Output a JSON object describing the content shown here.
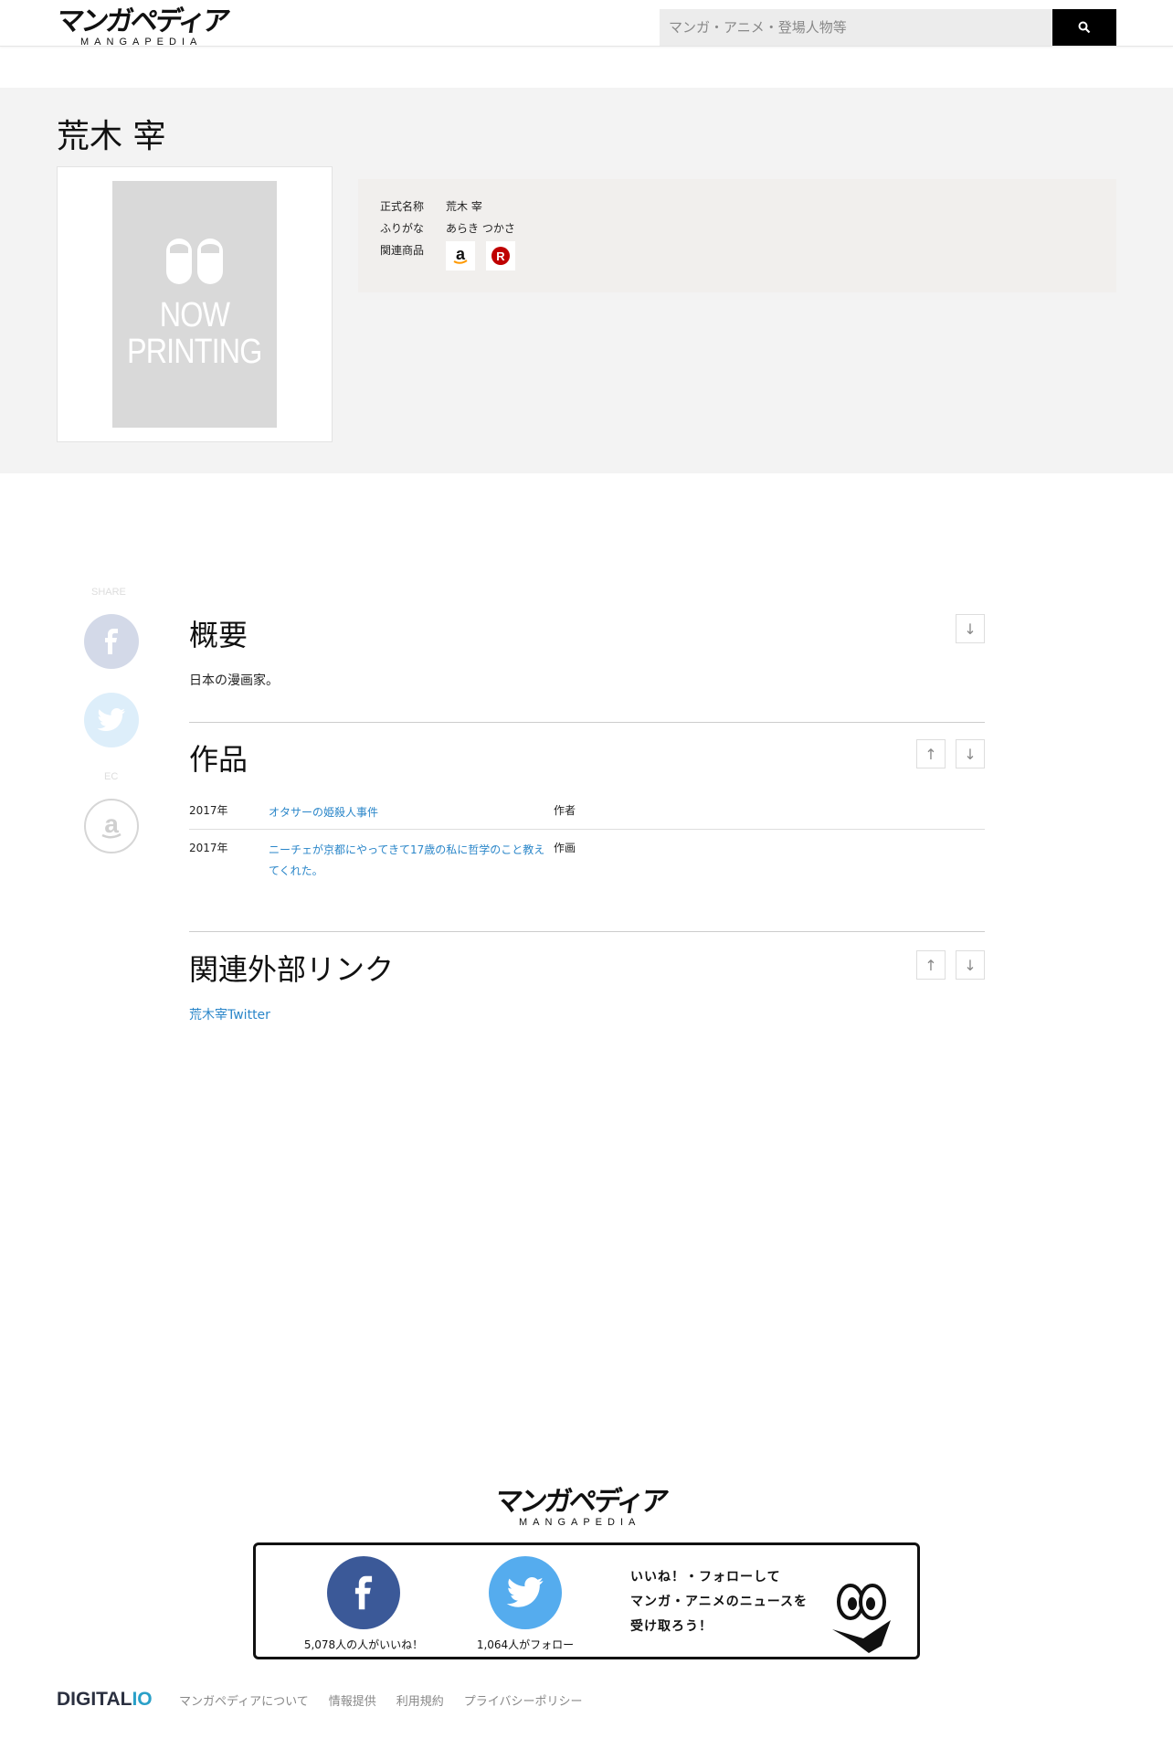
{
  "header": {
    "logo_jp": "マンガペディア",
    "logo_en": "MANGAPEDIA",
    "search_placeholder": "マンガ・アニメ・登場人物等",
    "search_icon": "search-icon"
  },
  "profile": {
    "name": "荒木 宰",
    "cover_text": [
      "NOW",
      "PRINTING"
    ],
    "official_name_label": "正式名称",
    "official_name": "荒木 宰",
    "furigana_label": "ふりがな",
    "furigana": "あらき つかさ",
    "products_label": "関連商品",
    "product_icons": [
      "amazon-icon",
      "rakuten-icon"
    ]
  },
  "share": {
    "share_label": "SHARE",
    "ec_label": "EC"
  },
  "overview": {
    "title": "概要",
    "text": "日本の漫画家。"
  },
  "works": {
    "title": "作品",
    "rows": [
      {
        "year": "2017年",
        "title": "オタサーの姫殺人事件",
        "role": "作者"
      },
      {
        "year": "2017年",
        "title": "ニーチェが京都にやってきて17歳の私に哲学のこと教えてくれた。",
        "role": "作画"
      }
    ]
  },
  "links": {
    "title": "関連外部リンク",
    "items": [
      "荒木宰Twitter"
    ]
  },
  "footer": {
    "logo_jp": "マンガペディア",
    "logo_en": "MANGAPEDIA",
    "fb_count": "5,078人の人がいいね！",
    "tw_count": "1,064人がフォロー",
    "follow_msg": [
      "いいね！・フォローして",
      "マンガ・アニメのニュースを",
      "受け取ろう！"
    ],
    "company_name": "DIGITAL",
    "company_suffix": "IO",
    "nav": [
      "マンガペディアについて",
      "情報提供",
      "利用規約",
      "プライバシーポリシー"
    ]
  },
  "colors": {
    "link": "#2a86c9",
    "facebook": "#3b5998",
    "twitter": "#55acee"
  }
}
